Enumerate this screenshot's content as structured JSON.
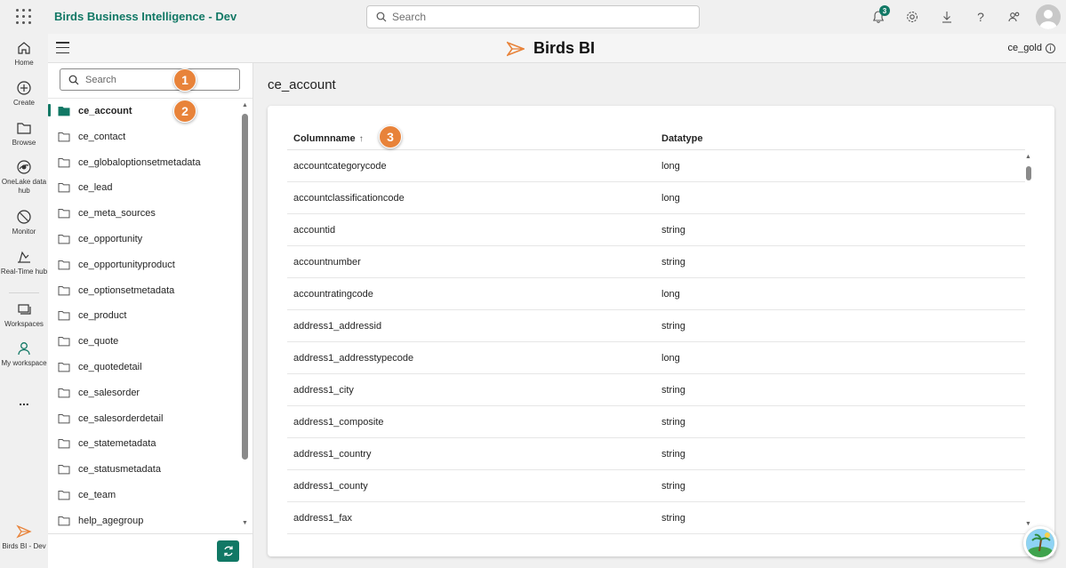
{
  "app": {
    "title": "Birds Business Intelligence - Dev",
    "search_placeholder": "Search",
    "notification_count": "3",
    "brand_name": "Birds BI",
    "user_label": "ce_gold",
    "accent_color": "#117865",
    "callout_color": "#e8833a"
  },
  "rail": {
    "items": [
      {
        "label": "Home",
        "icon": "home-icon"
      },
      {
        "label": "Create",
        "icon": "create-icon"
      },
      {
        "label": "Browse",
        "icon": "browse-icon"
      },
      {
        "label": "OneLake data hub",
        "icon": "onelake-icon"
      },
      {
        "label": "Monitor",
        "icon": "monitor-icon"
      },
      {
        "label": "Real-Time hub",
        "icon": "realtime-icon"
      },
      {
        "label": "Workspaces",
        "icon": "workspaces-icon"
      },
      {
        "label": "My workspace",
        "icon": "my-workspace-icon"
      },
      {
        "label": "...",
        "icon": "more-icon"
      },
      {
        "label": "Birds BI - Dev",
        "icon": "birds-bi-icon"
      }
    ]
  },
  "sidebar": {
    "search_placeholder": "Search",
    "tables": [
      "ce_account",
      "ce_contact",
      "ce_globaloptionsetmetadata",
      "ce_lead",
      "ce_meta_sources",
      "ce_opportunity",
      "ce_opportunityproduct",
      "ce_optionsetmetadata",
      "ce_product",
      "ce_quote",
      "ce_quotedetail",
      "ce_salesorder",
      "ce_salesorderdetail",
      "ce_statemetadata",
      "ce_statusmetadata",
      "ce_team",
      "help_agegroup"
    ],
    "selected": "ce_account"
  },
  "main": {
    "title": "ce_account",
    "columns": {
      "name": "Columnname",
      "type": "Datatype",
      "sort_indicator": "↑"
    },
    "rows": [
      {
        "name": "accountcategorycode",
        "type": "long"
      },
      {
        "name": "accountclassificationcode",
        "type": "long"
      },
      {
        "name": "accountid",
        "type": "string"
      },
      {
        "name": "accountnumber",
        "type": "string"
      },
      {
        "name": "accountratingcode",
        "type": "long"
      },
      {
        "name": "address1_addressid",
        "type": "string"
      },
      {
        "name": "address1_addresstypecode",
        "type": "long"
      },
      {
        "name": "address1_city",
        "type": "string"
      },
      {
        "name": "address1_composite",
        "type": "string"
      },
      {
        "name": "address1_country",
        "type": "string"
      },
      {
        "name": "address1_county",
        "type": "string"
      },
      {
        "name": "address1_fax",
        "type": "string"
      }
    ]
  },
  "callouts": [
    "1",
    "2",
    "3"
  ]
}
